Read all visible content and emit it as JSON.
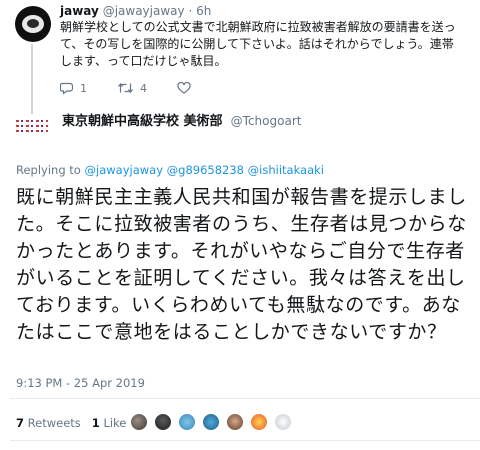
{
  "first_tweet": {
    "name": "jaway",
    "handle": "@jawayjaway",
    "dot": "·",
    "time": "6h",
    "text": "朝鮮学校としての公式文書で北朝鮮政府に拉致被害者解放の要請書を送って、その写しを国際的に公開して下さいよ。話はそれからでしょう。連帯します、って口だけじゃ駄目。",
    "replies": "1",
    "retweets": "4",
    "likes": ""
  },
  "second_tweet": {
    "name": "東京朝鮮中高級学校 美術部",
    "handle": "@Tchogoart",
    "replying_prefix": "Replying to",
    "replying_to": "@jawayjaway @g89658238 @ishiitakaaki",
    "text": "既に朝鮮民主主義人民共和国が報告書を提示しました。そこに拉致被害者のうち、生存者は見つからなかったとあります。それがいやならご自分で生存者がいることを証明してください。我々は答えを出しております。いくらわめいても無駄なのです。あなたはここで意地をはることしかできないですか？",
    "timestamp": "9:13 PM - 25 Apr 2019",
    "retweet_count": "7",
    "retweet_label": "Retweets",
    "like_count": "1",
    "like_label": "Like"
  },
  "colors": {
    "link": "#1b95e0",
    "muted": "#657786",
    "text": "#14171a",
    "divider": "#e6ecf0"
  },
  "icons": [
    "reply-icon",
    "retweet-icon",
    "like-icon"
  ]
}
